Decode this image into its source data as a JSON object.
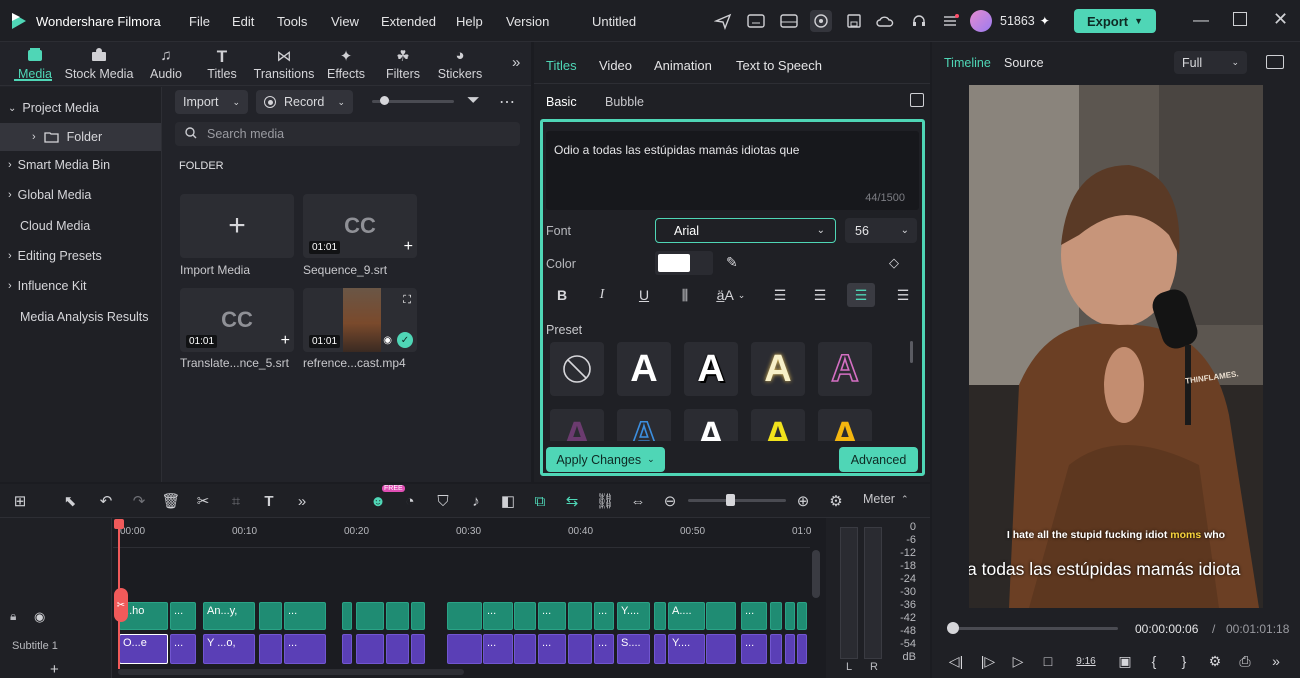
{
  "app": {
    "name": "Wondershare Filmora",
    "project": "Untitled",
    "credits": "51863",
    "export_label": "Export"
  },
  "menu": [
    "File",
    "Edit",
    "Tools",
    "View",
    "Extended",
    "Help",
    "Version"
  ],
  "media_tabs": [
    {
      "label": "Media",
      "icon": "media-icon",
      "active": true
    },
    {
      "label": "Stock Media",
      "icon": "stock-media-icon"
    },
    {
      "label": "Audio",
      "icon": "music-note-icon"
    },
    {
      "label": "Titles",
      "icon": "titles-icon"
    },
    {
      "label": "Transitions",
      "icon": "transitions-icon"
    },
    {
      "label": "Effects",
      "icon": "effects-icon"
    },
    {
      "label": "Filters",
      "icon": "filters-icon"
    },
    {
      "label": "Stickers",
      "icon": "stickers-icon"
    }
  ],
  "sidebar": {
    "items": [
      "Project Media",
      "Folder",
      "Smart Media Bin",
      "Global Media",
      "Cloud Media",
      "Editing Presets",
      "Influence Kit",
      "Media Analysis Results"
    ]
  },
  "media": {
    "import_label": "Import",
    "record_label": "Record",
    "search_placeholder": "Search media",
    "folder_heading": "FOLDER",
    "items": [
      {
        "label": "Import Media"
      },
      {
        "label": "Sequence_9.srt",
        "duration": "01:01",
        "thumb": "CC"
      },
      {
        "label": "Translate...nce_5.srt",
        "duration": "01:01",
        "thumb": "CC"
      },
      {
        "label": "refrence...cast.mp4",
        "duration": "01:01"
      }
    ]
  },
  "editor": {
    "tabs": [
      "Titles",
      "Video",
      "Animation",
      "Text to Speech"
    ],
    "subtabs": [
      "Basic",
      "Bubble"
    ],
    "text": "Odio a todas las estúpidas mamás idiotas que",
    "char_count": "44/1500",
    "font_label": "Font",
    "font_value": "Arial",
    "size_value": "56",
    "color_label": "Color",
    "color_value": "#ffffff",
    "preset_label": "Preset",
    "apply_label": "Apply Changes",
    "advanced_label": "Advanced"
  },
  "preview": {
    "tabs": [
      "Timeline",
      "Source"
    ],
    "zoom": "Full",
    "subtitle_en_pre": "I hate all the stupid fucking idiot ",
    "subtitle_en_hl": "moms",
    "subtitle_en_post": " who",
    "subtitle_es": "a todas las estúpidas mamás idiota",
    "current_time": "00:00:00:06",
    "separator": "/",
    "total_time": "00:01:01:18",
    "hoodie_text": "THINFLAMES."
  },
  "timeline": {
    "ruler": [
      "00:00",
      "00:10",
      "00:20",
      "00:30",
      "00:40",
      "00:50",
      "01:0"
    ],
    "meter_label": "Meter",
    "meter_scale": [
      "0",
      "-6",
      "-12",
      "-18",
      "-24",
      "-30",
      "-36",
      "-42",
      "-48",
      "-54",
      "dB"
    ],
    "meter_channels": [
      "L",
      "R"
    ],
    "track_label": "Subtitle 1",
    "green_clips": [
      "...ho",
      "...",
      "An...y,",
      "...",
      "...",
      "...",
      "...",
      "Y....",
      "A....",
      "..."
    ],
    "purple_clips": [
      "O...e",
      "...",
      "Y ...o,",
      "...",
      "...",
      "...",
      "...",
      "S....",
      "Y....",
      "..."
    ]
  },
  "colors": {
    "accent": "#4fd6b6",
    "purple": "#5a3fb6",
    "green": "#1f8c73",
    "playhead": "#f05a5a"
  }
}
